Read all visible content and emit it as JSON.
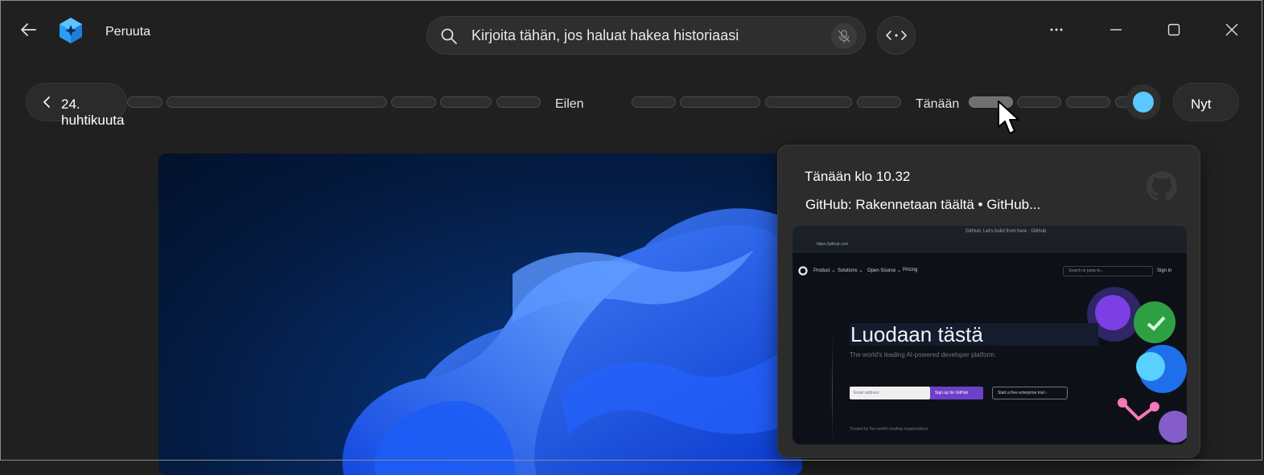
{
  "header": {
    "app_title": "Peruuta",
    "search_placeholder": "Kirjoita tähän, jos haluat hakea historiaasi"
  },
  "timeline": {
    "date_button": "24. huhtikuuta",
    "label_yesterday": "Eilen",
    "label_today": "Tänään",
    "now_button": "Nyt"
  },
  "card": {
    "time": "Tänään klo 10.32",
    "title": "GitHub: Rakennetaan täältä • GitHub...",
    "thumb": {
      "tab_title": "GitHub: Let's build from here · GitHub",
      "url": "https://github.com",
      "nav_product": "Product ⌄",
      "nav_solutions": "Solutions ⌄",
      "nav_open_source": "Open Source ⌄",
      "nav_pricing": "Pricing",
      "search_text": "Search or jump to...",
      "sign_in": "Sign in",
      "sign_up_short": "Sign",
      "hero": "Luodaan tästä",
      "subtitle": "The world's leading AI-powered developer platform.",
      "email_placeholder": "Email address",
      "signup_button": "Sign up for GitHub",
      "trial_button": "Start a free enterprise trial  ›",
      "trusted": "Trusted by the world's leading organizations"
    }
  },
  "colors": {
    "background": "#202020",
    "accent_dot": "#5cc8ff",
    "github_purple": "#6e40c9"
  },
  "icons": [
    "back-arrow-icon",
    "recall-logo-icon",
    "search-icon",
    "mic-off-icon",
    "code-icon",
    "more-icon",
    "minimize-icon",
    "maximize-icon",
    "close-icon",
    "chevron-left-icon",
    "github-icon",
    "mouse-cursor-icon"
  ]
}
